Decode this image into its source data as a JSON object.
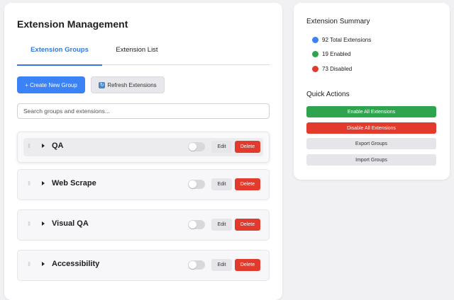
{
  "main": {
    "title": "Extension Management",
    "tabs": [
      {
        "label": "Extension Groups",
        "active": true
      },
      {
        "label": "Extension List",
        "active": false
      }
    ],
    "create_label": "+ Create New Group",
    "refresh_label": "Refresh Extensions",
    "search": {
      "placeholder": "Search groups and extensions...",
      "value": ""
    },
    "groups": [
      {
        "name": "QA",
        "edit_label": "Edit",
        "delete_label": "Delete",
        "enabled": false
      },
      {
        "name": "Web Scrape",
        "edit_label": "Edit",
        "delete_label": "Delete",
        "enabled": false
      },
      {
        "name": "Visual QA",
        "edit_label": "Edit",
        "delete_label": "Delete",
        "enabled": false
      },
      {
        "name": "Accessibility",
        "edit_label": "Edit",
        "delete_label": "Delete",
        "enabled": false
      }
    ]
  },
  "summary": {
    "title": "Extension Summary",
    "total": "92 Total Extensions",
    "enabled": "19 Enabled",
    "disabled": "73 Disabled",
    "colors": {
      "total": "#3b82f6",
      "enabled": "#2ea44f",
      "disabled": "#e23b2e"
    }
  },
  "quick_actions": {
    "title": "Quick Actions",
    "enable_all": "Enable All Extensions",
    "disable_all": "Disable All Extensions",
    "export": "Export Groups",
    "import": "Import Groups"
  },
  "icons": {
    "refresh": "refresh-icon",
    "drag": "drag-handle-icon",
    "expand": "chevron-right-icon"
  }
}
